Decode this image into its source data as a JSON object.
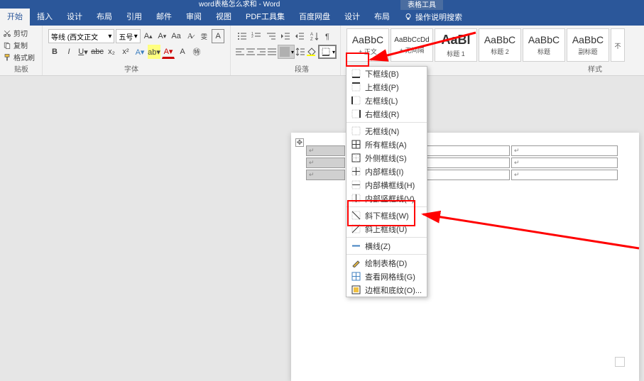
{
  "title": "word表格怎么求和 - Word",
  "context_tab": "表格工具",
  "tabs": [
    "开始",
    "插入",
    "设计",
    "布局",
    "引用",
    "邮件",
    "审阅",
    "视图",
    "PDF工具集",
    "百度网盘",
    "设计",
    "布局"
  ],
  "tell_me": "操作说明搜索",
  "clipboard": {
    "cut": "剪切",
    "copy": "复制",
    "format_painter": "格式刷",
    "label": "贴板"
  },
  "font": {
    "name": "等线 (西文正文",
    "size": "五号",
    "label": "字体"
  },
  "paragraph": {
    "label": "段落"
  },
  "styles": {
    "label": "样式",
    "items": [
      {
        "preview": "AaBbC",
        "label": "+ 正文"
      },
      {
        "preview": "AaBbCcDd",
        "label": "+ 无间隔"
      },
      {
        "preview": "AaBl",
        "label": "标题 1"
      },
      {
        "preview": "AaBbC",
        "label": "标题 2"
      },
      {
        "preview": "AaBbC",
        "label": "标题"
      },
      {
        "preview": "AaBbC",
        "label": "副标题"
      },
      {
        "preview": "不"
      }
    ]
  },
  "border_menu": [
    {
      "icon": "bottom",
      "text": "下框线(B)"
    },
    {
      "icon": "top",
      "text": "上框线(P)"
    },
    {
      "icon": "left",
      "text": "左框线(L)"
    },
    {
      "icon": "right",
      "text": "右框线(R)"
    },
    {
      "sep": true
    },
    {
      "icon": "none",
      "text": "无框线(N)"
    },
    {
      "icon": "all",
      "text": "所有框线(A)"
    },
    {
      "icon": "outside",
      "text": "外侧框线(S)"
    },
    {
      "icon": "inside",
      "text": "内部框线(I)"
    },
    {
      "icon": "inside-h",
      "text": "内部横框线(H)"
    },
    {
      "icon": "inside-v",
      "text": "内部竖框线(V)"
    },
    {
      "sep": true
    },
    {
      "icon": "diag-down",
      "text": "斜下框线(W)"
    },
    {
      "icon": "diag-up",
      "text": "斜上框线(U)"
    },
    {
      "sep": true
    },
    {
      "icon": "hline",
      "text": "横线(Z)"
    },
    {
      "sep": true
    },
    {
      "icon": "draw",
      "text": "绘制表格(D)"
    },
    {
      "icon": "grid",
      "text": "查看网格线(G)"
    },
    {
      "icon": "shading",
      "text": "边框和底纹(O)..."
    }
  ],
  "table_cells": {
    "mark": "↵"
  }
}
